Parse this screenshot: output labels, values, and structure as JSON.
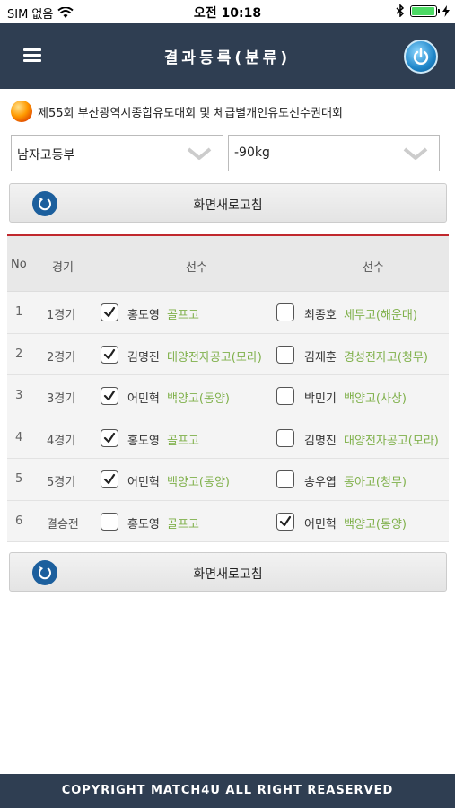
{
  "status": {
    "carrier": "SIM 없음",
    "time": "오전 10:18",
    "battery_level": 0.95
  },
  "header": {
    "title": "결과등록(분류)",
    "menu_icon": "hamburger-icon",
    "power_icon": "power-icon"
  },
  "event_title": "제55회 부산광역시종합유도대회 및 체급별개인유도선수권대회",
  "filters": {
    "division": "남자고등부",
    "weight": "-90kg"
  },
  "refresh_label": "화면새로고침",
  "table": {
    "headers": {
      "no": "No",
      "game": "경기",
      "player1": "선수",
      "player2": "선수"
    },
    "rows": [
      {
        "no": "1",
        "game": "1경기",
        "p1_checked": true,
        "p1_name": "홍도영",
        "p1_school": "골프고",
        "p2_checked": false,
        "p2_name": "최종호",
        "p2_school": "세무고(해운대)"
      },
      {
        "no": "2",
        "game": "2경기",
        "p1_checked": true,
        "p1_name": "김명진",
        "p1_school": "대양전자공고(모라)",
        "p2_checked": false,
        "p2_name": "김재훈",
        "p2_school": "경성전자고(청무)"
      },
      {
        "no": "3",
        "game": "3경기",
        "p1_checked": true,
        "p1_name": "어민혁",
        "p1_school": "백양고(동양)",
        "p2_checked": false,
        "p2_name": "박민기",
        "p2_school": "백양고(사상)"
      },
      {
        "no": "4",
        "game": "4경기",
        "p1_checked": true,
        "p1_name": "홍도영",
        "p1_school": "골프고",
        "p2_checked": false,
        "p2_name": "김명진",
        "p2_school": "대양전자공고(모라)"
      },
      {
        "no": "5",
        "game": "5경기",
        "p1_checked": true,
        "p1_name": "어민혁",
        "p1_school": "백양고(동양)",
        "p2_checked": false,
        "p2_name": "송우엽",
        "p2_school": "동아고(청무)"
      },
      {
        "no": "6",
        "game": "결승전",
        "p1_checked": false,
        "p1_name": "홍도영",
        "p1_school": "골프고",
        "p2_checked": true,
        "p2_name": "어민혁",
        "p2_school": "백양고(동양)"
      }
    ]
  },
  "footer": "COPYRIGHT MATCH4U ALL RIGHT REASERVED"
}
